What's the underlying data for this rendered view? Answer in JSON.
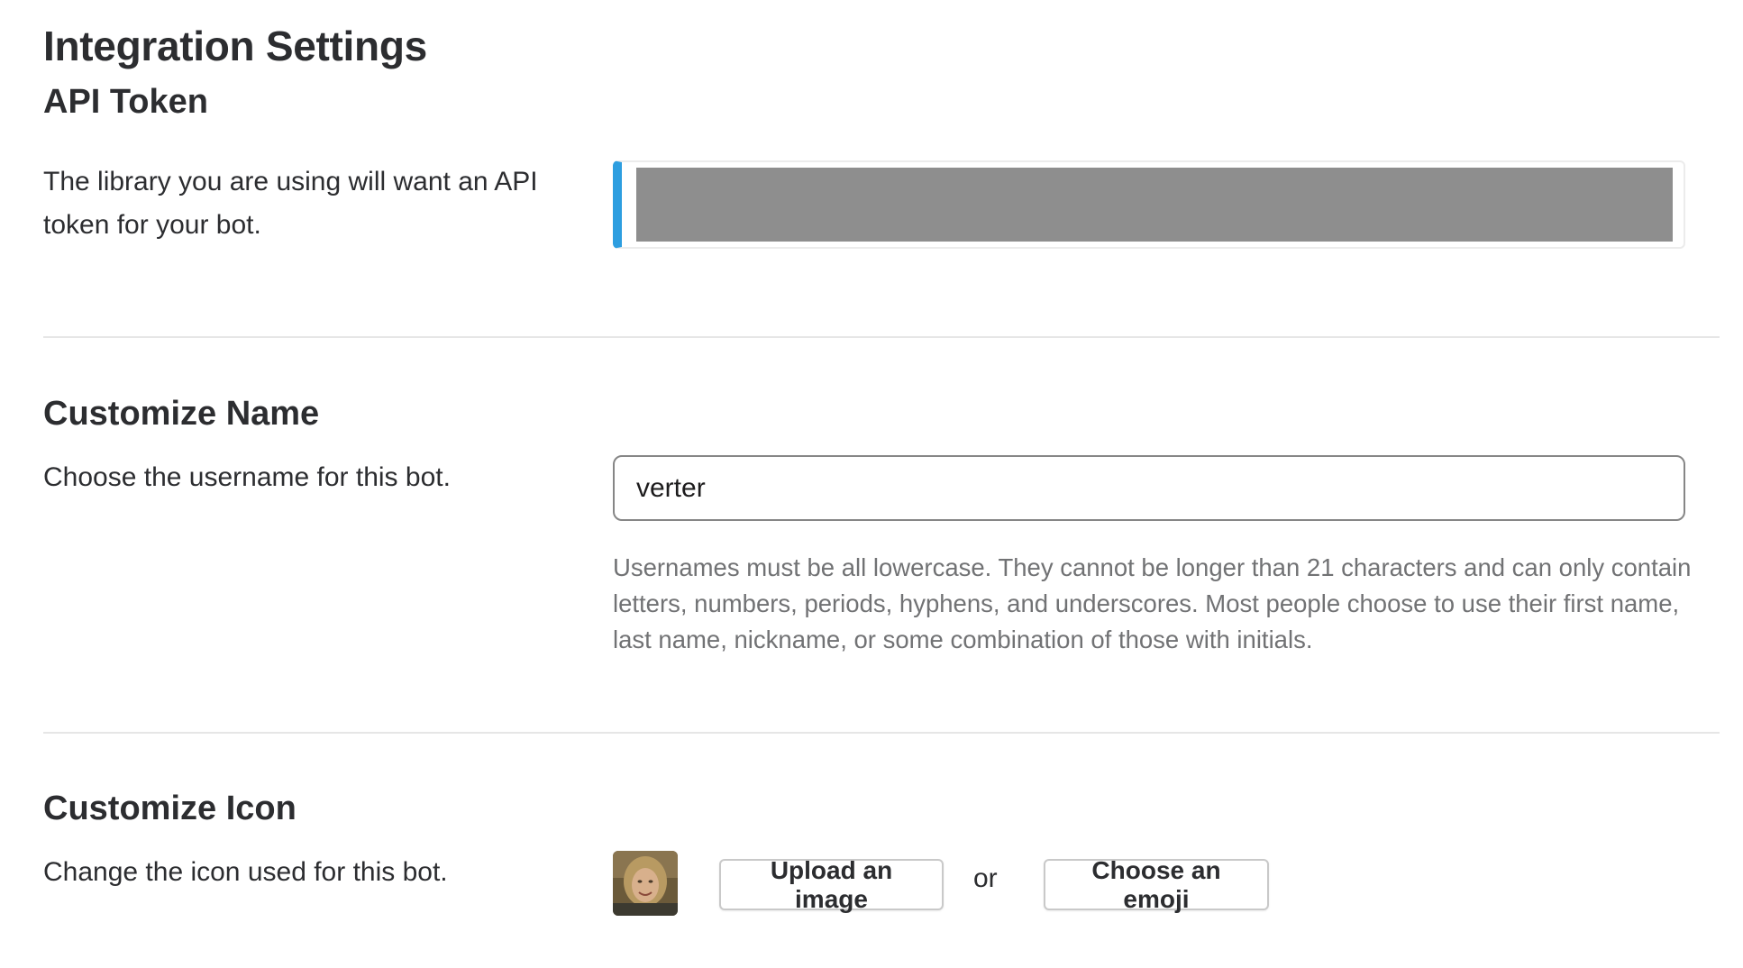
{
  "page": {
    "title": "Integration Settings"
  },
  "api_token": {
    "title": "API Token",
    "description": "The library you are using will want an API token for your bot.",
    "accent_color": "#2d9ee0"
  },
  "customize_name": {
    "title": "Customize Name",
    "description": "Choose the username for this bot.",
    "username_value": "verter",
    "hint": "Usernames must be all lowercase. They cannot be longer than 21 characters and can only contain letters, numbers, periods, hyphens, and underscores. Most people choose to use their first name, last name, nickname, or some combination of those with initials."
  },
  "customize_icon": {
    "title": "Customize Icon",
    "description": "Change the icon used for this bot.",
    "upload_label": "Upload an image",
    "or_label": "or",
    "emoji_label": "Choose an emoji"
  }
}
